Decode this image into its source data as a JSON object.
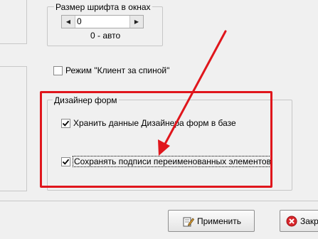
{
  "font_size_group": {
    "title": "Размер шрифта в окнах",
    "spin_value": "0",
    "hint": "0 - авто"
  },
  "client_behind_back": {
    "label": "Режим \"Клиент за спиной\"",
    "checked": false
  },
  "form_designer": {
    "title": "Дизайнер форм",
    "store_in_db_label": "Хранить данные Дизайнера форм в базе",
    "store_in_db_checked": true,
    "save_captions_label": "Сохранять подписи переименованных элементов",
    "save_captions_checked": true
  },
  "buttons": {
    "apply_label": "Применить",
    "close_label": "Закр"
  },
  "colors": {
    "highlight": "#e0161c",
    "background": "#f0f0f0"
  },
  "icons": {
    "apply": "apply-pencil-icon",
    "close": "close-x-icon"
  }
}
